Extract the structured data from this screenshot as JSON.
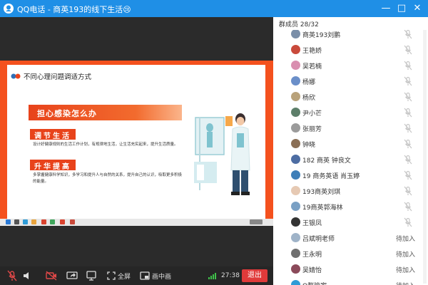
{
  "window": {
    "title": "QQ电话 - 商英193的线下生活😢",
    "controls": [
      "minimize",
      "maximize",
      "close"
    ]
  },
  "slide": {
    "title": "不同心理问题调适方式",
    "band_heading": "担心感染怎么办",
    "sections": [
      {
        "label": "调节生活",
        "text": "设计好健康规则的生活工作计划，有规律地生活，让生活充实起来，提升生活质量。"
      },
      {
        "label": "升华提高",
        "text": "多掌握健康科学知识，多学习和提升人与自然的关系，提升自己的认识，吸取更多积极的能量。"
      }
    ]
  },
  "controlbar": {
    "fullscreen_label": "全屏",
    "pip_label": "画中画",
    "timer": "27:38",
    "exit_label": "退出"
  },
  "panel": {
    "header": "群成员 28/32",
    "members": [
      {
        "name": "商英193刘鹏",
        "status": "",
        "mic": "muted",
        "avatar": "#7a8ea8"
      },
      {
        "name": "王艳娇",
        "status": "",
        "mic": "muted",
        "avatar": "#c94a3b"
      },
      {
        "name": "吴若楠",
        "status": "",
        "mic": "muted",
        "avatar": "#d98fb0"
      },
      {
        "name": "杨娜",
        "status": "",
        "mic": "muted",
        "avatar": "#6b8fc9"
      },
      {
        "name": "杨欣",
        "status": "",
        "mic": "muted",
        "avatar": "#b9a27a"
      },
      {
        "name": "尹小芒",
        "status": "",
        "mic": "muted",
        "avatar": "#5d7f6a"
      },
      {
        "name": "张丽芳",
        "status": "",
        "mic": "muted",
        "avatar": "#9b9b9b"
      },
      {
        "name": "钟晓",
        "status": "",
        "mic": "muted",
        "avatar": "#8a6f55"
      },
      {
        "name": "182 商英 钟良文",
        "status": "",
        "mic": "muted",
        "avatar": "#4d6da3"
      },
      {
        "name": "19 商务英语 肖玉婷",
        "status": "",
        "mic": "muted",
        "avatar": "#3f7fb8"
      },
      {
        "name": "193商英刘琪",
        "status": "",
        "mic": "muted",
        "avatar": "#e6c9b3"
      },
      {
        "name": "19商英郭海林",
        "status": "",
        "mic": "muted",
        "avatar": "#7aa0c4"
      },
      {
        "name": "王银凤",
        "status": "",
        "mic": "muted",
        "avatar": "#333333"
      },
      {
        "name": "吕斌明老师",
        "status": "待加入",
        "mic": "",
        "avatar": "#9fb3c8"
      },
      {
        "name": "王永明",
        "status": "待加入",
        "mic": "",
        "avatar": "#6f6f6f"
      },
      {
        "name": "吴婧怡",
        "status": "待加入",
        "mic": "",
        "avatar": "#8b4a5a"
      },
      {
        "name": "Q群管家",
        "status": "待加入",
        "mic": "",
        "avatar": "#2f9bd6"
      }
    ]
  },
  "colors": {
    "titlebar": "#1f8fe6",
    "accent_orange": "#e8431b",
    "exit_red": "#e03a3a",
    "signal_green": "#3fc24a"
  },
  "icons": {
    "logo": "qq-call-icon",
    "slide_logo": "slide-logo-icon",
    "mic_off": "mic-off-icon",
    "speaker": "speaker-icon",
    "camera_off": "camera-off-icon",
    "share": "share-screen-icon",
    "whiteboard": "whiteboard-icon",
    "fullscreen": "fullscreen-icon",
    "pip": "pip-icon",
    "signal": "signal-icon"
  }
}
